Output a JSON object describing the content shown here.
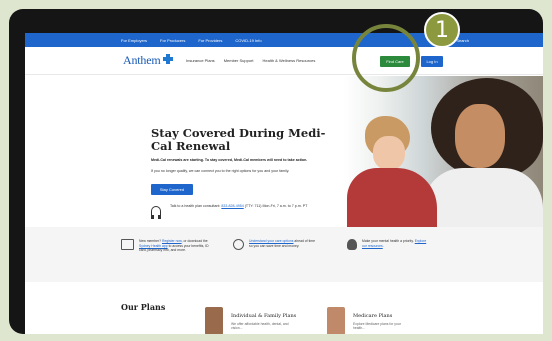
{
  "topbar": {
    "links": [
      "For Employers",
      "For Producers",
      "For Providers",
      "COVID-19 Info"
    ],
    "search_label": "Search"
  },
  "nav": {
    "logo_text": "Anthem",
    "links": [
      "Insurance Plans",
      "Member Support",
      "Health & Wellness Resources"
    ],
    "find_care": "Find Care",
    "login": "Log In"
  },
  "hero": {
    "title": "Stay Covered During Medi-Cal Renewal",
    "p1": "Medi-Cal renewals are starting. To stay covered, Medi-Cal members will need to take action.",
    "p2": "If you no longer qualify, we can connect you to the right options for you and your family.",
    "button": "Stay Covered",
    "talk_pre": "Talk to a health plan consultant: ",
    "talk_phone": "833-828-4954",
    "talk_post": " (TTY: 711) Mon-Fri, 7 a.m. to 7 p.m. PT"
  },
  "info": [
    {
      "pre": "New member? ",
      "link1": "Register now",
      "mid": ", or download the ",
      "link2": "Sydney Health app",
      "post": " to access your benefits, ID card, pharmacy info, and more."
    },
    {
      "pre": "",
      "link1": "Understand your care options",
      "mid": " ahead of time so you can save time and money.",
      "link2": "",
      "post": ""
    },
    {
      "pre": "Make your mental health a priority. ",
      "link1": "Explore our resources",
      "mid": ".",
      "link2": "",
      "post": ""
    }
  ],
  "plans": {
    "title": "Our Plans",
    "cards": [
      {
        "name": "Individual & Family Plans",
        "desc": "We offer affordable health, dental, and vision..."
      },
      {
        "name": "Medicare Plans",
        "desc": "Explore Medicare plans for your health..."
      }
    ]
  },
  "callout": {
    "number": "1"
  },
  "colors": {
    "brand_blue": "#1f66cc",
    "find_care_green": "#2c8a3c",
    "callout_olive": "#8d993f",
    "background": "#dfe6cf"
  }
}
